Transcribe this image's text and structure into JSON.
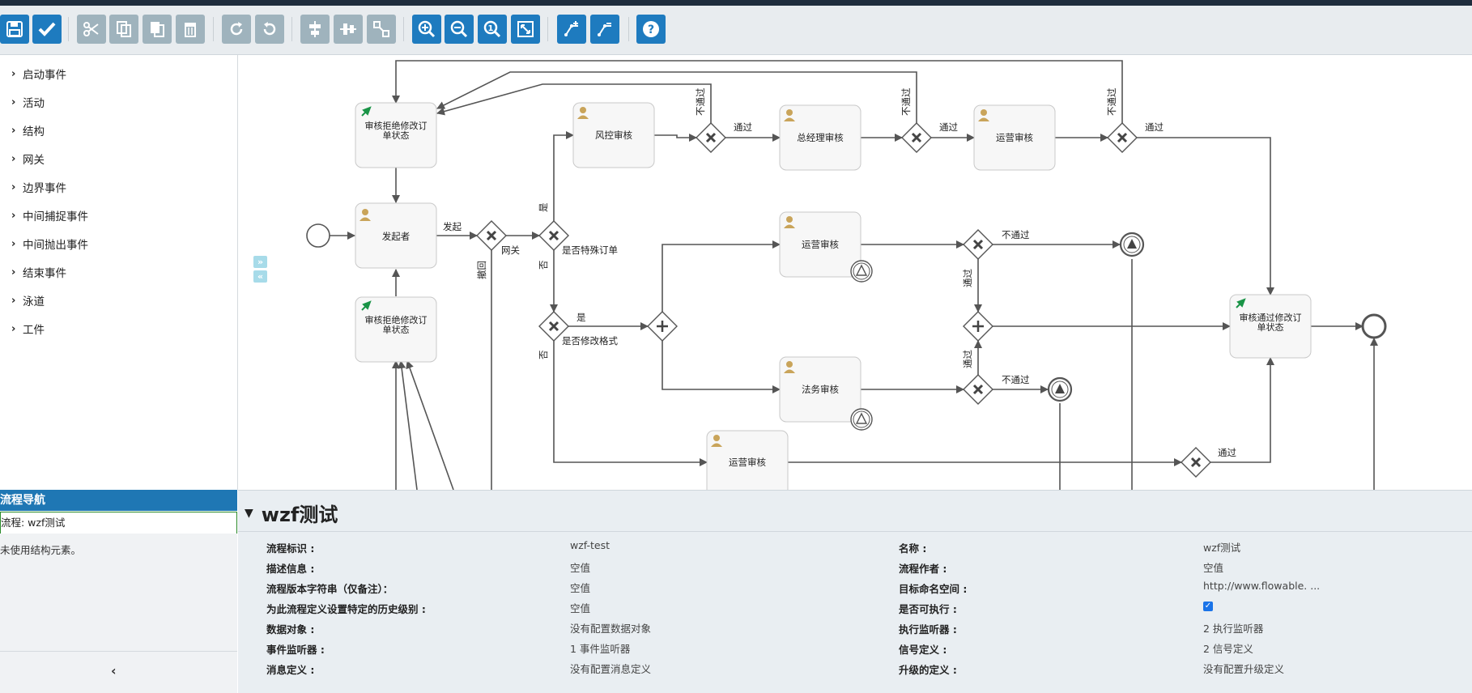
{
  "toolbar": {
    "buttons": [
      {
        "name": "save",
        "state": "primary"
      },
      {
        "name": "validate",
        "state": "primary"
      },
      {
        "name": "cut",
        "state": "disabled"
      },
      {
        "name": "copy",
        "state": "disabled"
      },
      {
        "name": "paste",
        "state": "disabled"
      },
      {
        "name": "delete",
        "state": "disabled"
      },
      {
        "name": "redo",
        "state": "disabled"
      },
      {
        "name": "undo",
        "state": "disabled"
      },
      {
        "name": "align-horizontal",
        "state": "disabled"
      },
      {
        "name": "align-vertical",
        "state": "disabled"
      },
      {
        "name": "same-size",
        "state": "disabled"
      },
      {
        "name": "zoom-in",
        "state": "primary"
      },
      {
        "name": "zoom-out",
        "state": "primary"
      },
      {
        "name": "zoom-actual",
        "state": "primary"
      },
      {
        "name": "zoom-fit",
        "state": "primary"
      },
      {
        "name": "add-bendpoint",
        "state": "primary"
      },
      {
        "name": "remove-bendpoint",
        "state": "primary"
      },
      {
        "name": "help",
        "state": "primary"
      }
    ]
  },
  "palette": {
    "items": [
      "启动事件",
      "活动",
      "结构",
      "网关",
      "边界事件",
      "中间捕捉事件",
      "中间抛出事件",
      "结束事件",
      "泳道",
      "工件"
    ]
  },
  "diagram": {
    "tasks": {
      "reject_top": "审核拒绝修改订单状态",
      "initiator": "发起者",
      "reject_bottom": "审核拒绝修改订单状态",
      "risk": "风控审核",
      "gm": "总经理审核",
      "ops_top": "运营审核",
      "ops_mid": "运营审核",
      "legal": "法务审核",
      "ops_bottom": "运营审核",
      "approve": "审核通过修改订单状态"
    },
    "labels": {
      "launch": "发起",
      "gateway": "网关",
      "special": "是否特殊订单",
      "modify": "是否修改格式",
      "yes": "是",
      "no": "否",
      "pass": "通过",
      "reject": "不通过",
      "withdraw": "撤回"
    }
  },
  "nav": {
    "header": "流程导航",
    "flow": "流程: wzf测试",
    "empty": "未使用结构元素。"
  },
  "props": {
    "title": "wzf测试",
    "rows": [
      {
        "label": "流程标识 :",
        "value": "wzf-test",
        "label2": "名称 :",
        "value2": "wzf测试"
      },
      {
        "label": "描述信息 :",
        "value": "空值",
        "label2": "流程作者 :",
        "value2": "空值"
      },
      {
        "label": "流程版本字符串（仅备注）：",
        "value": "空值",
        "label2": "目标命名空间 :",
        "value2": "http://www.flowable. ..."
      },
      {
        "label": "为此流程定义设置特定的历史级别 :",
        "value": "空值",
        "label2": "是否可执行 :",
        "value2": ""
      },
      {
        "label": "数据对象 :",
        "value": "没有配置数据对象",
        "label2": "执行监听器 :",
        "value2": "2 执行监听器"
      },
      {
        "label": "事件监听器 :",
        "value": "1 事件监听器",
        "label2": "信号定义 :",
        "value2": "2 信号定义"
      },
      {
        "label": "消息定义 :",
        "value": "没有配置消息定义",
        "label2": "升级的定义 :",
        "value2": "没有配置升级定义"
      }
    ],
    "executable": true
  },
  "colors": {
    "primary": "#1e7bbf",
    "disabled": "#9fb3bd",
    "nav_header": "#1f77b4",
    "task_fill": "#f7f7f7",
    "task_stroke": "#c8c8c8",
    "flow": "#555555"
  }
}
